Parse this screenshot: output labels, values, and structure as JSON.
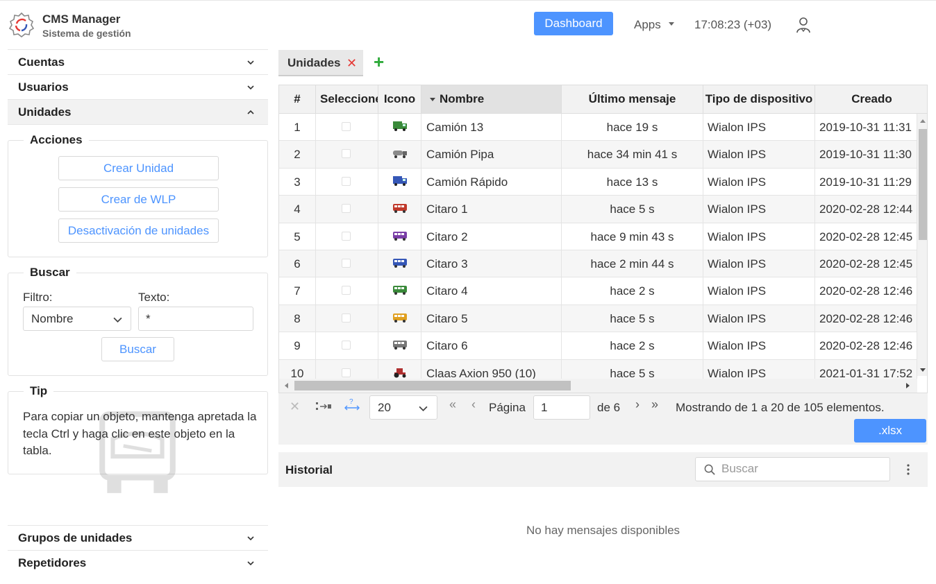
{
  "header": {
    "app_title": "CMS Manager",
    "app_subtitle": "Sistema de gestión",
    "dashboard_label": "Dashboard",
    "apps_label": "Apps",
    "clock": "17:08:23 (+03)"
  },
  "sidebar": {
    "items": [
      {
        "label": "Cuentas"
      },
      {
        "label": "Usuarios"
      },
      {
        "label": "Unidades"
      }
    ],
    "bottom_items": [
      {
        "label": "Grupos de unidades"
      },
      {
        "label": "Repetidores"
      }
    ],
    "actions": {
      "legend": "Acciones",
      "buttons": [
        "Crear Unidad",
        "Crear de WLP",
        "Desactivación de unidades"
      ]
    },
    "search": {
      "legend": "Buscar",
      "filter_label": "Filtro:",
      "filter_value": "Nombre",
      "text_label": "Texto:",
      "text_value": "*",
      "button": "Buscar"
    },
    "tip": {
      "legend": "Tip",
      "text": "Para copiar un objeto, mantenga apretada la tecla Ctrl y haga clic en este objeto en la tabla."
    }
  },
  "tabs": [
    {
      "label": "Unidades"
    }
  ],
  "table": {
    "columns": [
      "#",
      "Seleccione",
      "Icono",
      "Nombre",
      "Último mensaje",
      "Tipo de dispositivo",
      "Creado"
    ],
    "rows": [
      {
        "n": "1",
        "name": "Camión 13",
        "last": "hace 19 s",
        "type": "Wialon IPS",
        "created": "2019-10-31 11:31",
        "icon": "truck-icon",
        "color": "#3a8a3a"
      },
      {
        "n": "2",
        "name": "Camión Pipa",
        "last": "hace 34 min 41 s",
        "type": "Wialon IPS",
        "created": "2019-10-31 11:30",
        "icon": "tanker-icon",
        "color": "#8a8a8a"
      },
      {
        "n": "3",
        "name": "Camión Rápido",
        "last": "hace 13 s",
        "type": "Wialon IPS",
        "created": "2019-10-31 11:29",
        "icon": "truck-icon",
        "color": "#3557b7"
      },
      {
        "n": "4",
        "name": "Citaro 1",
        "last": "hace 5 s",
        "type": "Wialon IPS",
        "created": "2020-02-28 12:44",
        "icon": "bus-icon",
        "color": "#c0392b"
      },
      {
        "n": "5",
        "name": "Citaro 2",
        "last": "hace 9 min 43 s",
        "type": "Wialon IPS",
        "created": "2020-02-28 12:45",
        "icon": "bus-icon",
        "color": "#7b3fa8"
      },
      {
        "n": "6",
        "name": "Citaro 3",
        "last": "hace 2 min 44 s",
        "type": "Wialon IPS",
        "created": "2020-02-28 12:45",
        "icon": "bus-icon",
        "color": "#3557b7"
      },
      {
        "n": "7",
        "name": "Citaro 4",
        "last": "hace 2 s",
        "type": "Wialon IPS",
        "created": "2020-02-28 12:46",
        "icon": "bus-icon",
        "color": "#3a8a3a"
      },
      {
        "n": "8",
        "name": "Citaro 5",
        "last": "hace 5 s",
        "type": "Wialon IPS",
        "created": "2020-02-28 12:46",
        "icon": "bus-icon",
        "color": "#e0a020"
      },
      {
        "n": "9",
        "name": "Citaro 6",
        "last": "hace 2 s",
        "type": "Wialon IPS",
        "created": "2020-02-28 12:46",
        "icon": "bus-icon",
        "color": "#777777"
      },
      {
        "n": "10",
        "name": "Claas Axion 950 (10)",
        "last": "hace 5 s",
        "type": "Wialon IPS",
        "created": "2021-01-31 17:52",
        "icon": "tractor-icon",
        "color": "#b03030"
      }
    ]
  },
  "pager": {
    "page_size": "20",
    "page_label": "Página",
    "page": "1",
    "of_label": "de 6",
    "summary": "Mostrando de 1 a 20 de 105 elementos.",
    "export_label": ".xlsx"
  },
  "history": {
    "title": "Historial",
    "search_placeholder": "Buscar",
    "empty_text": "No hay mensajes disponibles"
  },
  "colors": {
    "accent": "#4d94ff",
    "add": "#2eaa3a",
    "close": "#e53935"
  }
}
